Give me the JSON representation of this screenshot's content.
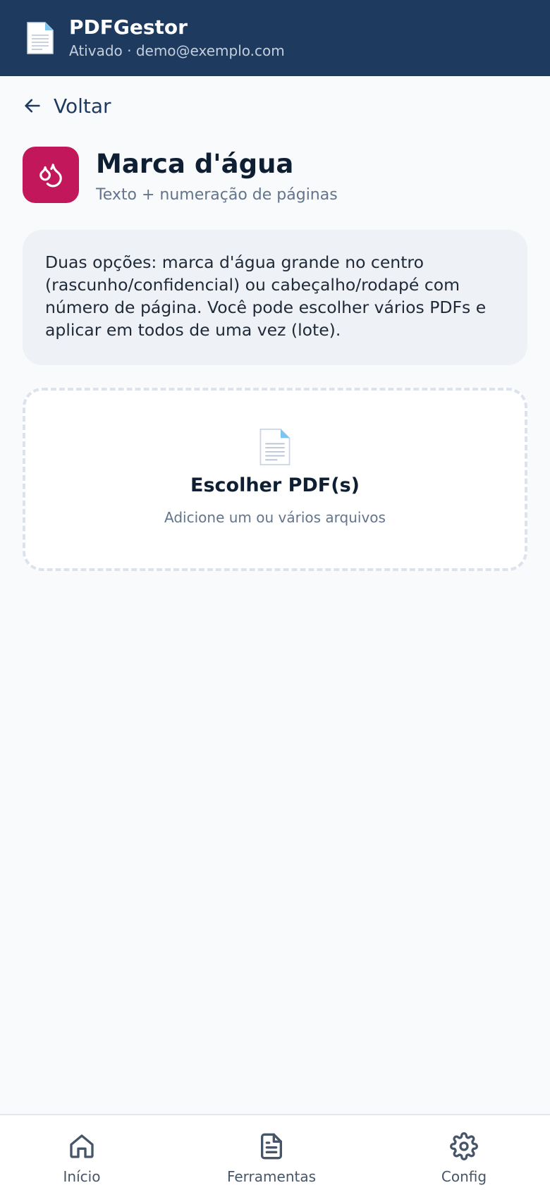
{
  "header": {
    "app_name": "PDFGestor",
    "status": "Ativado · demo@exemplo.com",
    "icon": "document-icon"
  },
  "back": {
    "label": "Voltar",
    "icon": "arrow-left-icon"
  },
  "tool": {
    "title": "Marca d'água",
    "subtitle": "Texto + numeração de páginas",
    "icon": "droplets-icon",
    "icon_color": "#c2185b"
  },
  "info": {
    "text": "Duas opções: marca d'água grande no centro (rascunho/confidencial) ou cabeçalho/rodapé com número de página. Você pode escolher vários PDFs e aplicar em todos de uma vez (lote)."
  },
  "dropzone": {
    "title": "Escolher PDF(s)",
    "hint": "Adicione um ou vários arquivos",
    "icon": "document-icon"
  },
  "nav": {
    "items": [
      {
        "label": "Início",
        "icon": "home-icon"
      },
      {
        "label": "Ferramentas",
        "icon": "file-text-icon"
      },
      {
        "label": "Config",
        "icon": "gear-icon"
      }
    ]
  },
  "colors": {
    "header_bg": "#1e3a5f",
    "accent": "#c2185b",
    "page_bg": "#f8fafc"
  }
}
